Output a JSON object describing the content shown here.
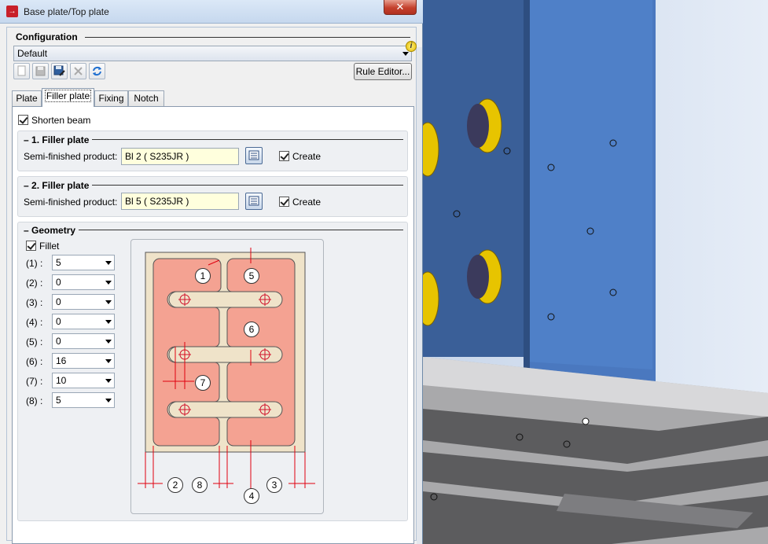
{
  "window": {
    "title": "Base plate/Top plate",
    "close_glyph": "✕"
  },
  "configuration": {
    "title": "Configuration",
    "selected": "Default",
    "rule_editor_label": "Rule Editor..."
  },
  "toolbar_icons": [
    "new-icon",
    "save-icon",
    "save-as-icon",
    "delete-icon",
    "refresh-icon"
  ],
  "tabs": [
    {
      "label": "Plate",
      "active": false
    },
    {
      "label": "Filler plate",
      "active": true
    },
    {
      "label": "Fixing",
      "active": false
    },
    {
      "label": "Notch",
      "active": false
    }
  ],
  "shorten_beam": {
    "label": "Shorten beam",
    "checked": true
  },
  "filler1": {
    "title": "1. Filler plate",
    "product_label": "Semi-finished product:",
    "product_value": "Bl 2  ( S235JR )",
    "create_label": "Create",
    "create_checked": true
  },
  "filler2": {
    "title": "2. Filler plate",
    "product_label": "Semi-finished product:",
    "product_value": "Bl 5  ( S235JR )",
    "create_label": "Create",
    "create_checked": true
  },
  "geometry": {
    "title": "Geometry",
    "fillet_label": "Fillet",
    "fillet_checked": true,
    "params": [
      {
        "label": "(1) :",
        "value": "5"
      },
      {
        "label": "(2) :",
        "value": "0"
      },
      {
        "label": "(3) :",
        "value": "0"
      },
      {
        "label": "(4) :",
        "value": "0"
      },
      {
        "label": "(5) :",
        "value": "0"
      },
      {
        "label": "(6) :",
        "value": "16"
      },
      {
        "label": "(7) :",
        "value": "10"
      },
      {
        "label": "(8) :",
        "value": "5"
      }
    ]
  },
  "diagram_labels": [
    "1",
    "5",
    "6",
    "7",
    "2",
    "8",
    "4",
    "3"
  ],
  "colors": {
    "plate": "#f4a292",
    "plate_bg": "#efe3c9",
    "dim": "#e0000f",
    "steel": "#3f6aa8"
  }
}
